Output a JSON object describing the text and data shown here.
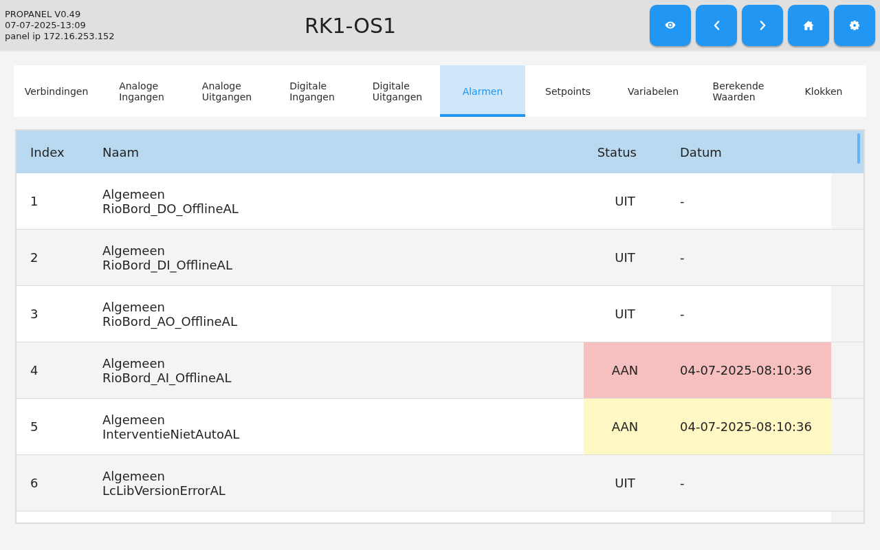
{
  "header": {
    "version": "PROPANEL V0.49",
    "datetime": "07-07-2025-13:09",
    "panel_ip": "panel ip 172.16.253.152",
    "title": "RK1-OS1"
  },
  "toolbar": [
    {
      "kind": "view"
    },
    {
      "kind": "back"
    },
    {
      "kind": "forward"
    },
    {
      "kind": "home"
    },
    {
      "kind": "settings"
    }
  ],
  "tabs": [
    {
      "label": "Verbindingen",
      "selected": false
    },
    {
      "label": "Analoge Ingangen",
      "selected": false
    },
    {
      "label": "Analoge Uitgangen",
      "selected": false
    },
    {
      "label": "Digitale Ingangen",
      "selected": false
    },
    {
      "label": "Digitale Uitgangen",
      "selected": false
    },
    {
      "label": "Alarmen",
      "selected": true
    },
    {
      "label": "Setpoints",
      "selected": false
    },
    {
      "label": "Variabelen",
      "selected": false
    },
    {
      "label": "Berekende Waarden",
      "selected": false
    },
    {
      "label": "Klokken",
      "selected": false
    }
  ],
  "alarms": {
    "columns": [
      "Index",
      "Naam",
      "Status",
      "Datum"
    ],
    "rows": [
      {
        "index": "1",
        "group": "Algemeen",
        "name": "RioBord_DO_OfflineAL",
        "status": "UIT",
        "date": "-"
      },
      {
        "index": "2",
        "group": "Algemeen",
        "name": "RioBord_DI_OfflineAL",
        "status": "UIT",
        "date": "-"
      },
      {
        "index": "3",
        "group": "Algemeen",
        "name": "RioBord_AO_OfflineAL",
        "status": "UIT",
        "date": "-"
      },
      {
        "index": "4",
        "group": "Algemeen",
        "name": "RioBord_AI_OfflineAL",
        "status": "AAN",
        "date": "04-07-2025-08:10:36",
        "color": "#f5c0bf"
      },
      {
        "index": "5",
        "group": "Algemeen",
        "name": "InterventieNietAutoAL",
        "status": "AAN",
        "date": "04-07-2025-08:10:36",
        "color": "#fff8c4"
      },
      {
        "index": "6",
        "group": "Algemeen",
        "name": "LcLibVersionErrorAL",
        "status": "UIT",
        "date": "-"
      }
    ]
  }
}
